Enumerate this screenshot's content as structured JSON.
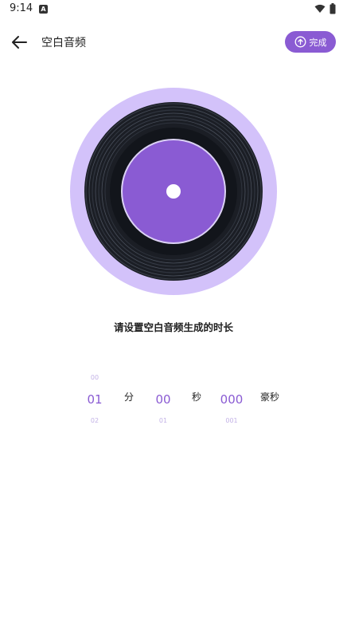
{
  "status": {
    "time": "9:14",
    "app_icon": "A"
  },
  "header": {
    "title": "空白音频",
    "done_label": "完成"
  },
  "prompt": "请设置空白音频生成的时长",
  "picker": {
    "minutes": {
      "prev": "00",
      "current": "01",
      "next": "02",
      "unit": "分"
    },
    "seconds": {
      "prev": "",
      "current": "00",
      "next": "01",
      "unit": "秒"
    },
    "milliseconds": {
      "prev": "",
      "current": "000",
      "next": "001",
      "unit": "豪秒"
    }
  },
  "colors": {
    "accent": "#8a5bd3",
    "ring": "#d3c2fa",
    "vinyl": "#1c1f26",
    "label": "#8a5bd3"
  },
  "icons": {
    "back": "arrow-left-icon",
    "done": "upload-icon",
    "disc": "vinyl-record-icon"
  }
}
